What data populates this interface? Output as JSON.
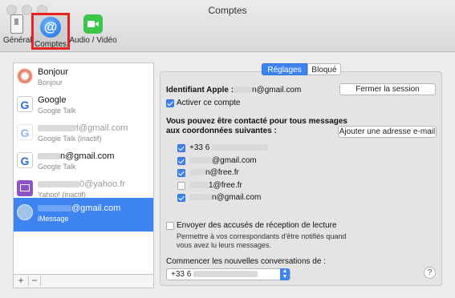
{
  "window": {
    "title": "Comptes"
  },
  "toolbar": {
    "items": [
      {
        "label": "Général",
        "icon": "general-switch-icon"
      },
      {
        "label": "Comptes",
        "icon": "at-sign-icon",
        "selected": true
      },
      {
        "label": "Audio / Vidéo",
        "icon": "video-camera-icon"
      }
    ]
  },
  "accounts": [
    {
      "name": "Bonjour",
      "sub": "Bonjour",
      "icon": "bonjour-icon"
    },
    {
      "name": "Google",
      "sub": "Google Talk",
      "icon": "google-icon"
    },
    {
      "name": "t@gmail.com",
      "sub": "Google Talk (inactif)",
      "icon": "google-icon",
      "dim": true
    },
    {
      "name": "n@gmail.com",
      "sub": "Google Talk",
      "icon": "google-icon"
    },
    {
      "name": "0@yahoo.fr",
      "sub": "Yahoo! (inactif)",
      "icon": "yahoo-mail-icon",
      "dim": true
    },
    {
      "name": "@gmail.com",
      "sub": "iMessage",
      "icon": "imessage-icon",
      "selected": true
    }
  ],
  "sidebar_footer": {
    "add": "+",
    "remove": "−"
  },
  "tabs": {
    "settings": "Réglages",
    "blocked": "Bloqué"
  },
  "settings": {
    "apple_id_label": "Identifiant Apple :",
    "apple_id_value": "n@gmail.com",
    "logout_button": "Fermer la session",
    "activate_label": "Activer ce compte",
    "contact_heading_1": "Vous pouvez être contacté pour tous messages",
    "contact_heading_2": "aux coordonnées suivantes :",
    "add_email_button": "Ajouter une adresse e-mail",
    "addresses": [
      {
        "text": "+33 6",
        "checked": true
      },
      {
        "text": "@gmail.com",
        "checked": true
      },
      {
        "text": "n@free.fr",
        "checked": true
      },
      {
        "text": "1@free.fr",
        "checked": false
      },
      {
        "text": "n@gmail.com",
        "checked": true
      }
    ],
    "read_receipts_label": "Envoyer des accusés de réception de lecture",
    "read_receipts_desc_1": "Permettre à vos correspondants d'être notifiés quand",
    "read_receipts_desc_2": "vous avez lu leurs messages.",
    "start_conversations_label": "Commencer les nouvelles conversations de :",
    "start_from_value": "+33 6",
    "help": "?"
  },
  "colors": {
    "accent": "#3d84f0",
    "highlight_box": "#e8231f",
    "video_icon": "#3bc54a"
  }
}
